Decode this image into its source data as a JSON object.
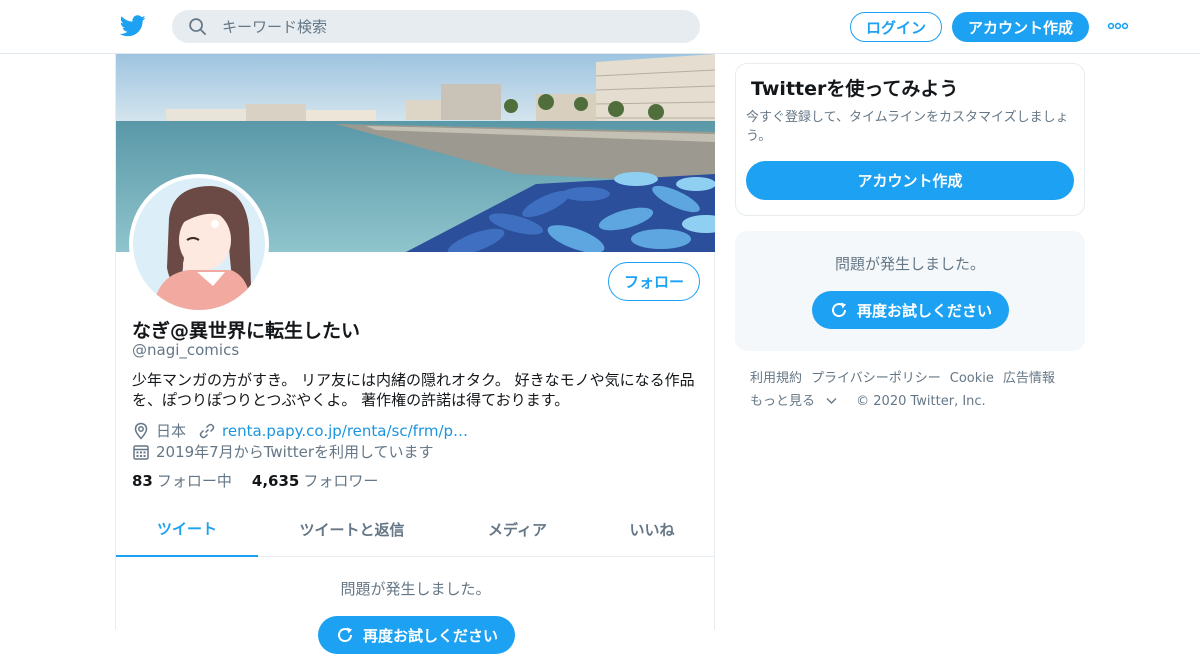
{
  "header": {
    "search_placeholder": "キーワード検索",
    "login_label": "ログイン",
    "signup_label": "アカウント作成"
  },
  "profile": {
    "display_name": "なぎ@異世界に転生したい",
    "handle": "@nagi_comics",
    "follow_label": "フォロー",
    "bio": "少年マンガの方がすき。 リア友には内緒の隠れオタク。 好きなモノや気になる作品を、ぽつりぽつりとつぶやくよ。 著作権の許諾は得ております。",
    "location": "日本",
    "url": "renta.papy.co.jp/renta/sc/frm/p…",
    "joined": "2019年7月からTwitterを利用しています",
    "following_count": "83",
    "following_label": "フォロー中",
    "followers_count": "4,635",
    "followers_label": "フォロワー"
  },
  "tabs": [
    {
      "label": "ツイート",
      "active": true
    },
    {
      "label": "ツイートと返信",
      "active": false
    },
    {
      "label": "メディア",
      "active": false
    },
    {
      "label": "いいね",
      "active": false
    }
  ],
  "timeline": {
    "error_message": "問題が発生しました。",
    "retry_label": "再度お試しください"
  },
  "sidebar": {
    "signup_card": {
      "title": "Twitterを使ってみよう",
      "description": "今すぐ登録して、タイムラインをカスタマイズしましょう。",
      "button_label": "アカウント作成"
    },
    "error_card": {
      "message": "問題が発生しました。",
      "retry_label": "再度お試しください"
    },
    "footer": {
      "links": [
        "利用規約",
        "プライバシーポリシー",
        "Cookie",
        "広告情報",
        "もっと見る"
      ],
      "copyright": "© 2020 Twitter, Inc."
    }
  },
  "colors": {
    "accent": "#1da1f2",
    "text_primary": "#14171a",
    "text_secondary": "#657786",
    "link": "#1b95e0"
  }
}
